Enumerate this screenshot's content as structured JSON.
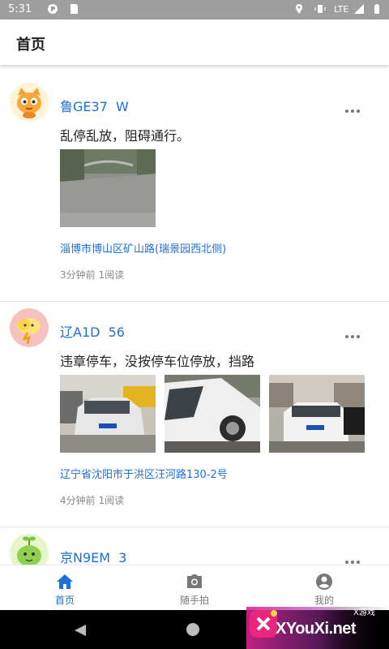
{
  "status_bar": {
    "time": "5:31",
    "network": "LTE"
  },
  "app_bar": {
    "title": "首页"
  },
  "posts": [
    {
      "user": "鲁GE37  W",
      "text": "乱停乱放，阻碍通行。",
      "location": "淄博市博山区矿山路(瑞景园西北侧)",
      "meta": "3分钟前 1阅读"
    },
    {
      "user": "辽A1D  56",
      "text": "违章停车，没按停车位停放，挡路",
      "location": "辽宁省沈阳市于洪区汪河路130-2号",
      "meta": "4分钟前 1阅读"
    },
    {
      "user": "京N9EM  3"
    }
  ],
  "bottom_nav": {
    "items": [
      {
        "label": "首页",
        "icon": "home-icon",
        "active": true
      },
      {
        "label": "随手拍",
        "icon": "camera-icon",
        "active": false
      },
      {
        "label": "我的",
        "icon": "account-icon",
        "active": false
      }
    ],
    "active_color": "#1e6fd9"
  },
  "watermark": {
    "brand": "XYouXi.net",
    "tag": "X游戏"
  }
}
